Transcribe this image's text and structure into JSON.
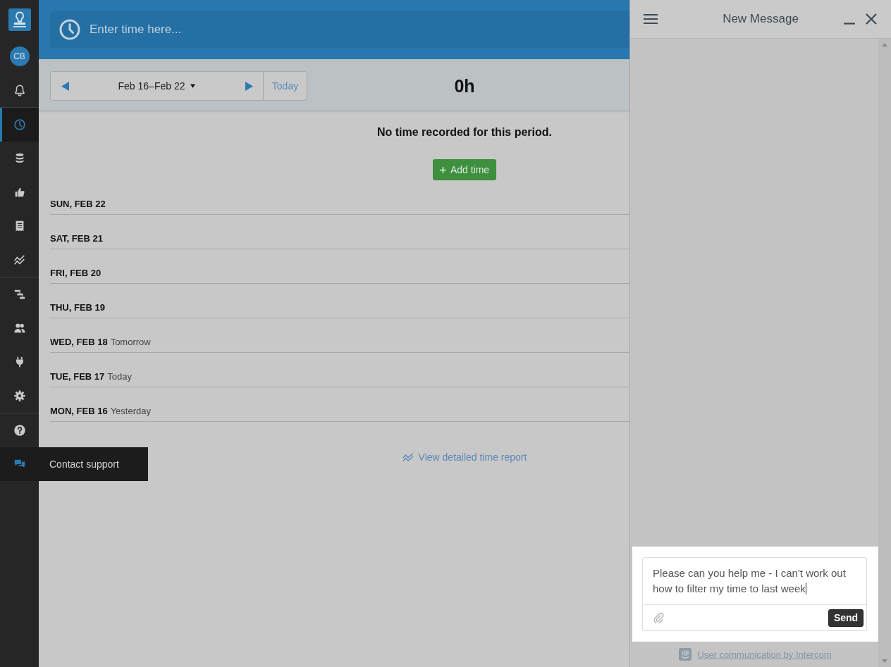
{
  "sidebar": {
    "avatar": "CB",
    "sections": [
      {
        "items": [
          {
            "selected": false
          }
        ]
      },
      {
        "items": [
          {
            "selected": true
          },
          {
            "selected": false
          },
          {
            "selected": false
          },
          {
            "selected": false
          },
          {
            "selected": false
          }
        ]
      },
      {
        "items": [
          {
            "selected": false
          },
          {
            "selected": false
          },
          {
            "selected": false
          },
          {
            "selected": false
          }
        ]
      },
      {
        "items": [
          {
            "selected": false
          },
          {
            "selected": false,
            "tooltip": "Contact support"
          }
        ]
      }
    ]
  },
  "time_entry": {
    "placeholder": "Enter time here..."
  },
  "toolbar": {
    "period": "Feb 16–Feb 22",
    "today_button": "Today",
    "total": "0h"
  },
  "empty_state": {
    "message": "No time recorded for this period.",
    "add_button": "Add time"
  },
  "days": [
    {
      "date": "SUN, FEB 22"
    },
    {
      "date": "SAT, FEB 21"
    },
    {
      "date": "FRI, FEB 20"
    },
    {
      "date": "THU, FEB 19"
    },
    {
      "date": "WED, FEB 18",
      "note": "Tomorrow"
    },
    {
      "date": "TUE, FEB 17",
      "note": "Today"
    },
    {
      "date": "MON, FEB 16",
      "note": "Yesterday"
    }
  ],
  "report_link": "View detailed time report",
  "message_panel": {
    "title": "New Message",
    "message": "Please can you help me - I can't work out how to filter my time to last week",
    "send_button": "Send",
    "footer_link": "User communication by Intercom"
  }
}
